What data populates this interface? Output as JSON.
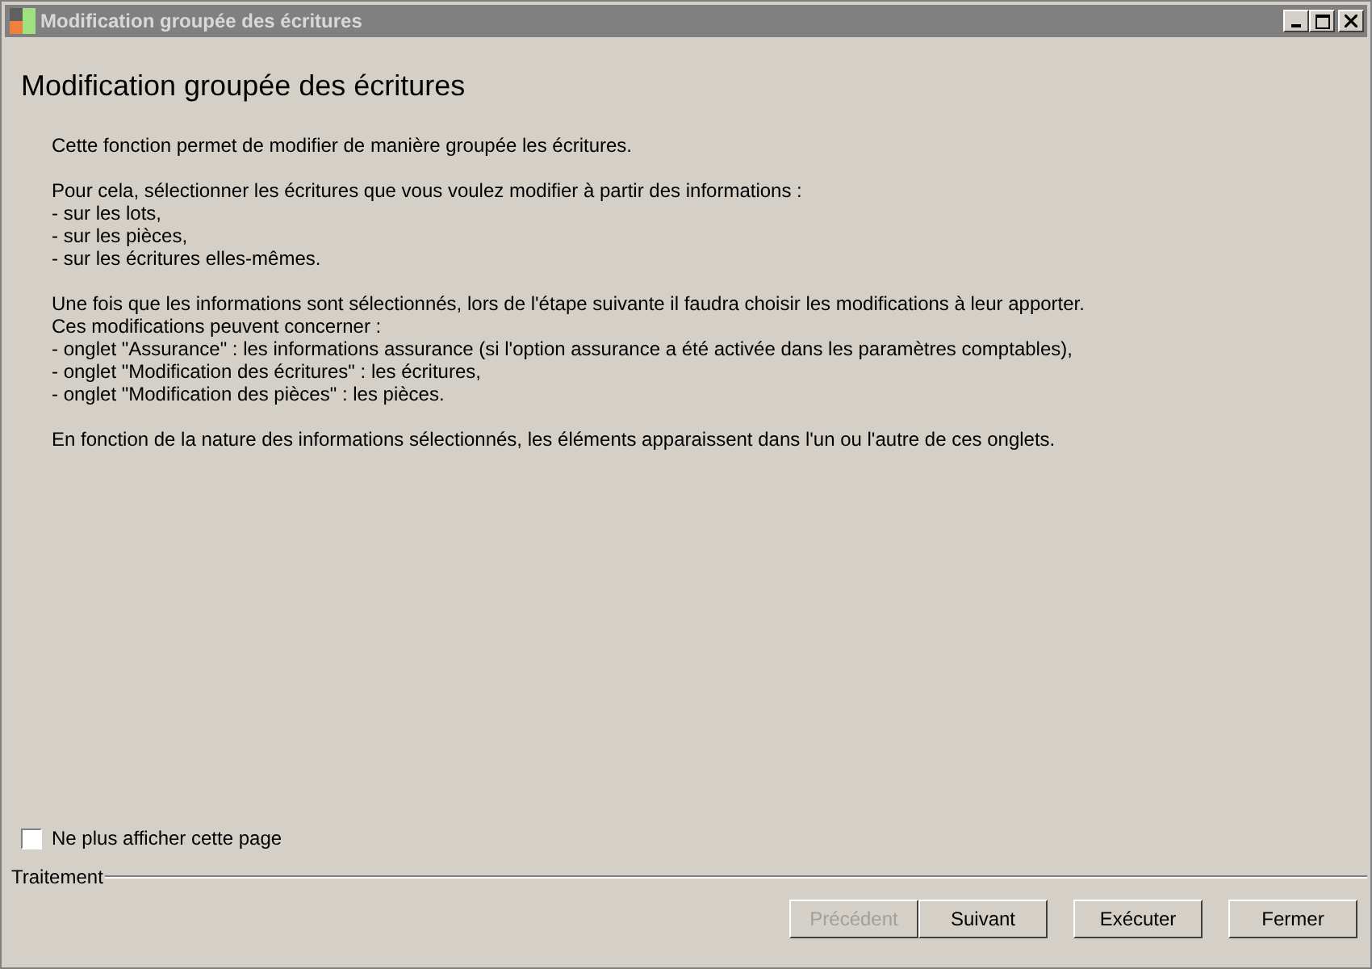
{
  "window": {
    "title": "Modification groupée des écritures"
  },
  "heading": "Modification groupée des écritures",
  "paragraphs": [
    [
      "Cette fonction permet de modifier de manière groupée les écritures."
    ],
    [
      "Pour cela, sélectionner les écritures que vous voulez modifier à partir des informations :",
      "- sur les lots,",
      "- sur les pièces,",
      "- sur les écritures elles-mêmes."
    ],
    [
      "Une fois que les informations sont sélectionnés, lors de l'étape suivante il faudra choisir les modifications à leur apporter.",
      "Ces modifications peuvent concerner :",
      "- onglet \"Assurance\" : les informations assurance (si l'option assurance a été activée dans les paramètres comptables),",
      "- onglet \"Modification des écritures\" : les écritures,",
      "- onglet \"Modification des pièces\" : les pièces."
    ],
    [
      "En fonction de la nature des informations sélectionnés, les éléments apparaissent dans l'un ou l'autre de ces onglets."
    ]
  ],
  "dont_show_checkbox": {
    "label": "Ne plus afficher cette page",
    "checked": false
  },
  "group_label": "Traitement",
  "buttons": [
    {
      "label": "Précédent",
      "disabled": true
    },
    {
      "label": "Suivant",
      "disabled": false
    },
    {
      "label": "Exécuter",
      "disabled": false
    },
    {
      "label": "Fermer",
      "disabled": false
    }
  ]
}
